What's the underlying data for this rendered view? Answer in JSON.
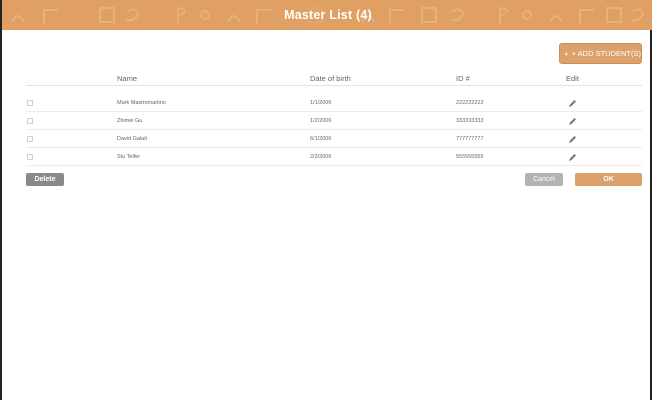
{
  "window": {
    "title": "Master List (4)"
  },
  "toolbar": {
    "add_students_label": "+ ADD STUDENT(S)"
  },
  "table": {
    "columns": [
      "Name",
      "Date of birth",
      "ID #",
      "Edit"
    ],
    "rows": [
      {
        "name": "Mark Mastromartino",
        "dob": "1/1/2006",
        "id": "222222222"
      },
      {
        "name": "Zhimei Gu",
        "dob": "1/2/2006",
        "id": "333333333"
      },
      {
        "name": "David Galati",
        "dob": "6/1/2006",
        "id": "777777777"
      },
      {
        "name": "Stu Telfer",
        "dob": "2/2/2006",
        "id": "555555555"
      }
    ]
  },
  "actions": {
    "delete_label": "Delete",
    "cancel_label": "Cancel",
    "ok_label": "OK"
  },
  "colors": {
    "accent": "#dca06a",
    "titlebar": "#e0a063",
    "delete": "#8a8a8a",
    "cancel": "#b3b3b3"
  },
  "icons": {
    "add_button": "user-icon",
    "edit": "pencil-icon"
  }
}
